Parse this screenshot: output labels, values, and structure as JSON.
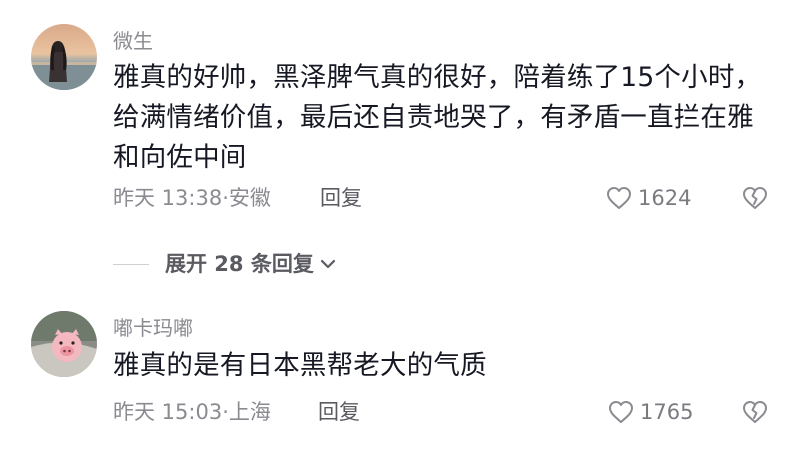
{
  "comments": [
    {
      "username": "微生",
      "text": "雅真的好帅，黑泽脾气真的很好，陪着练了15个小时，给满情绪价值，最后还自责地哭了，有矛盾一直拦在雅和向佐中间",
      "time_location": "昨天 13:38·安徽",
      "reply_label": "回复",
      "likes": "1624",
      "avatar_icon": "avatar-photo-beach-girl"
    },
    {
      "username": "嘟卡玛嘟",
      "text": "雅真的是有日本黑帮老大的气质",
      "time_location": "昨天 15:03·上海",
      "reply_label": "回复",
      "likes": "1765",
      "avatar_icon": "avatar-pig-cartoon"
    }
  ],
  "expand_replies": {
    "label": "展开 28 条回复",
    "icon": "chevron-down-icon"
  },
  "colors": {
    "text_primary": "#161823",
    "text_secondary": "#8a8b91",
    "icon_gray": "#8a8b91"
  }
}
